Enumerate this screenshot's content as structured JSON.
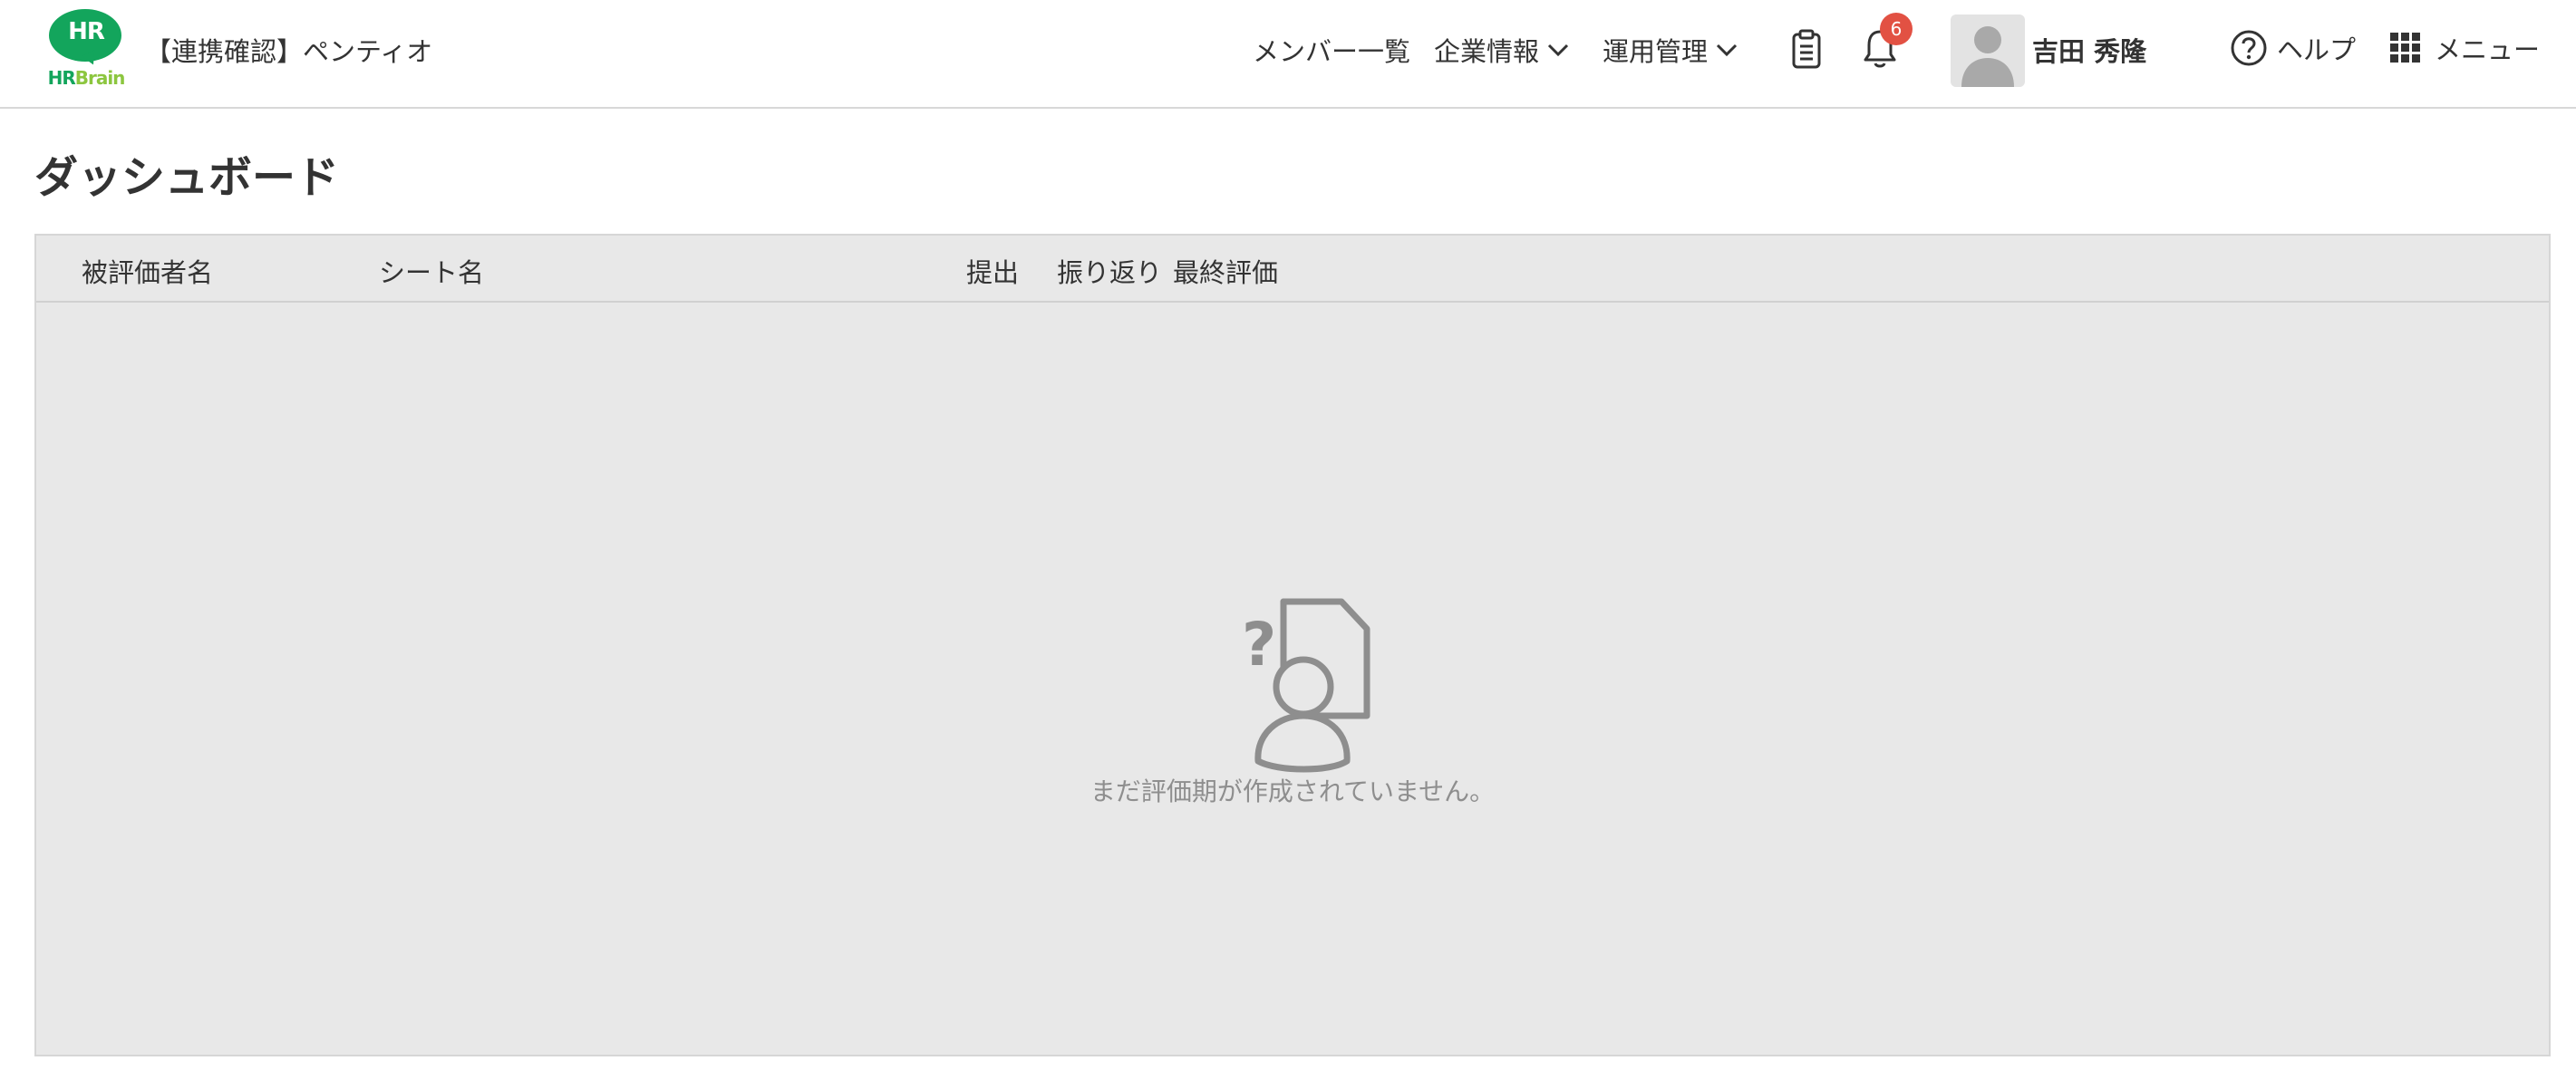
{
  "header": {
    "logo": {
      "mark": "HR",
      "word_a": "HR",
      "word_b": "Brain"
    },
    "company": "【連携確認】ペンティオ",
    "nav": [
      {
        "label": "メンバー一覧",
        "has_dropdown": false
      },
      {
        "label": "企業情報",
        "has_dropdown": true
      },
      {
        "label": "運用管理",
        "has_dropdown": true
      }
    ],
    "notification_count": "6",
    "user_name": "吉田 秀隆",
    "help_label": "ヘルプ",
    "menu_label": "メニュー",
    "icons": {
      "clipboard": "clipboard-icon",
      "bell": "bell-icon",
      "avatar": "user-avatar-icon",
      "help": "help-circle-icon",
      "menu": "grid-icon",
      "chevron": "chevron-down-icon"
    }
  },
  "page": {
    "title": "ダッシュボード"
  },
  "table": {
    "columns": [
      "被評価者名",
      "シート名",
      "提出",
      "振り返り",
      "最終評価"
    ],
    "rows": [],
    "empty_icon": "unknown-person-document-icon",
    "empty_message": "まだ評価期が作成されていません。"
  },
  "colors": {
    "brand_green": "#13a55c",
    "brand_light_green": "#8cc63f",
    "badge_red": "#e25143",
    "table_bg": "#e8e8e8",
    "muted_text": "#8e8e8e"
  }
}
